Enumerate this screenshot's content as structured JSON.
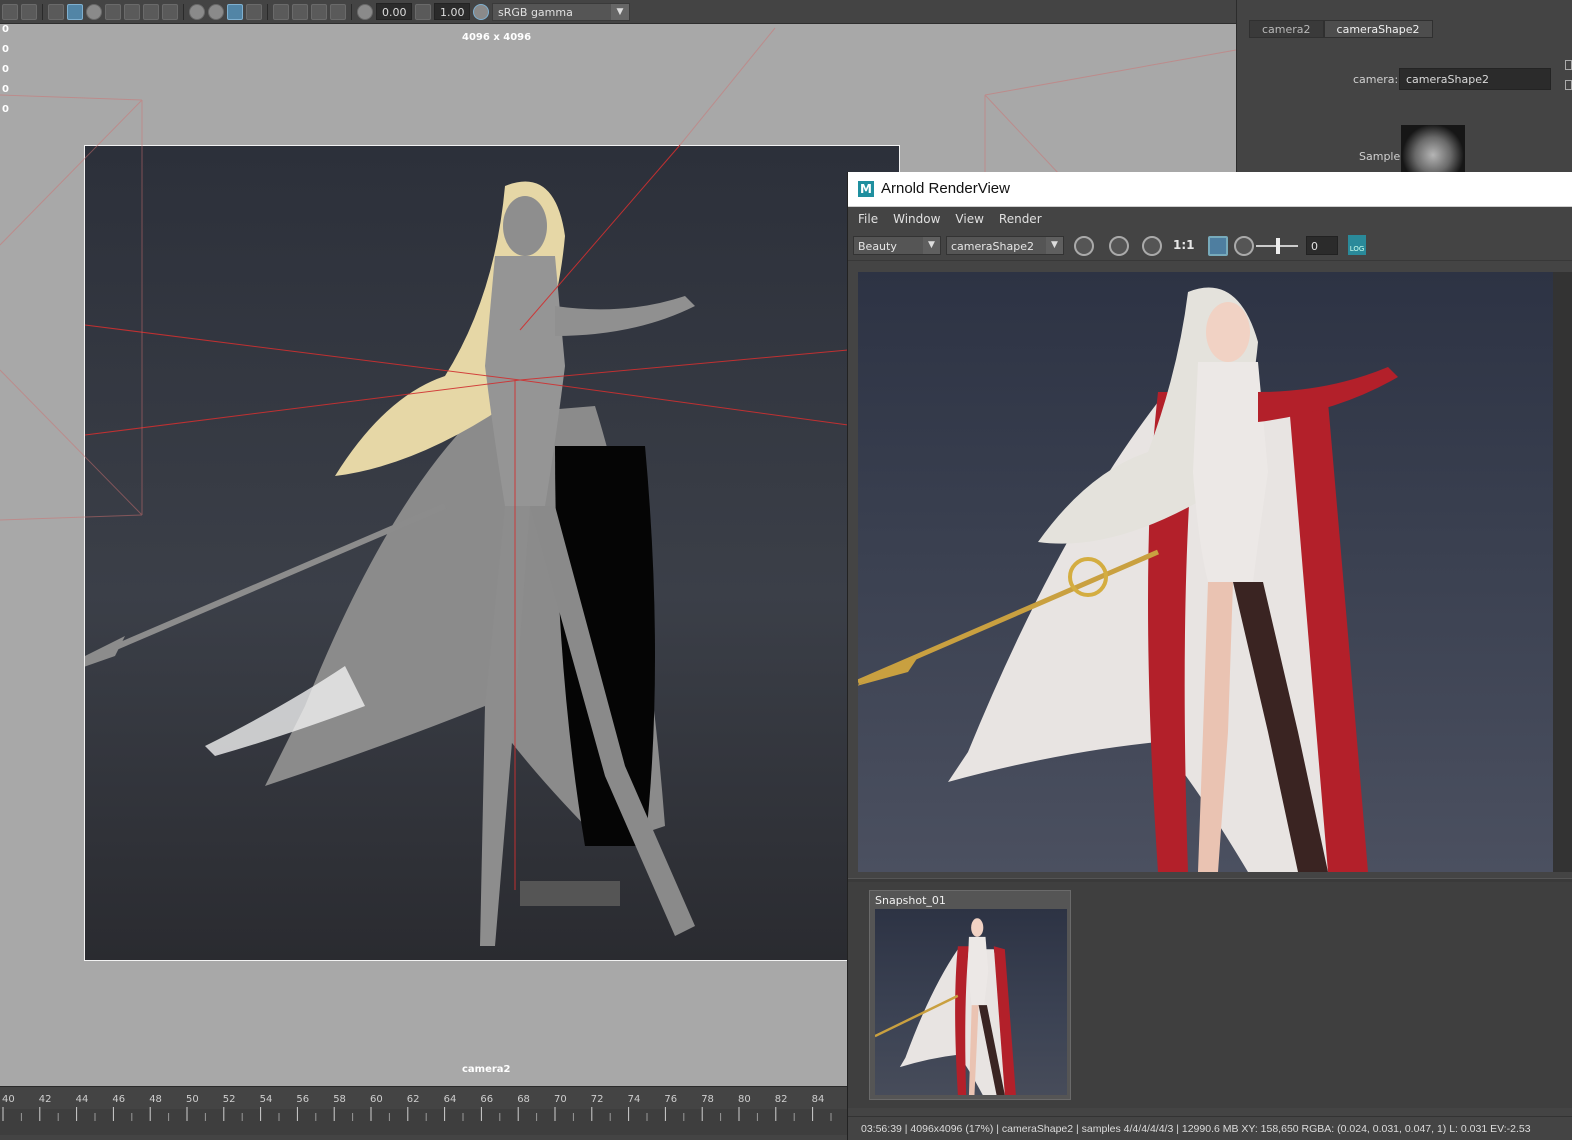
{
  "viewport": {
    "toolbar": {
      "exposure_value": "0.00",
      "gamma_value": "1.00",
      "color_space": "sRGB gamma"
    },
    "left_axis_labels": [
      "0",
      "0",
      "0",
      "0",
      "0"
    ],
    "resolution_label": "4096 x 4096",
    "camera_name": "camera2"
  },
  "timeline": {
    "ticks": [
      "40",
      "42",
      "44",
      "46",
      "48",
      "50",
      "52",
      "54",
      "56",
      "58",
      "60",
      "62",
      "64",
      "66",
      "68",
      "70",
      "72",
      "74",
      "76",
      "78",
      "80",
      "82",
      "84"
    ]
  },
  "attribute_editor": {
    "tabs": [
      {
        "label": "camera2",
        "active": false
      },
      {
        "label": "cameraShape2",
        "active": true
      }
    ],
    "camera_label": "camera:",
    "camera_value": "cameraShape2",
    "sample_label": "Sample"
  },
  "renderview": {
    "title": "Arnold RenderView",
    "logo": "M",
    "menu": [
      "File",
      "Window",
      "View",
      "Render"
    ],
    "aov_selected": "Beauty",
    "camera_selected": "cameraShape2",
    "ratio_label": "1:1",
    "exposure_value": "0",
    "log_label": "LOG",
    "snapshot_label": "Snapshot_01",
    "status_text": "03:56:39 | 4096x4096 (17%) | cameraShape2  | samples 4/4/4/4/4/3 | 12990.6 MB XY: 158,650   RGBA: (0.024, 0.031, 0.047, 1)     L: 0.031 EV:-2.53"
  },
  "colors": {
    "viewport_bg": "#a8a8a8",
    "panel_bg": "#444444",
    "accent_blue": "#5285a6",
    "frustum_red": "#d03030"
  }
}
